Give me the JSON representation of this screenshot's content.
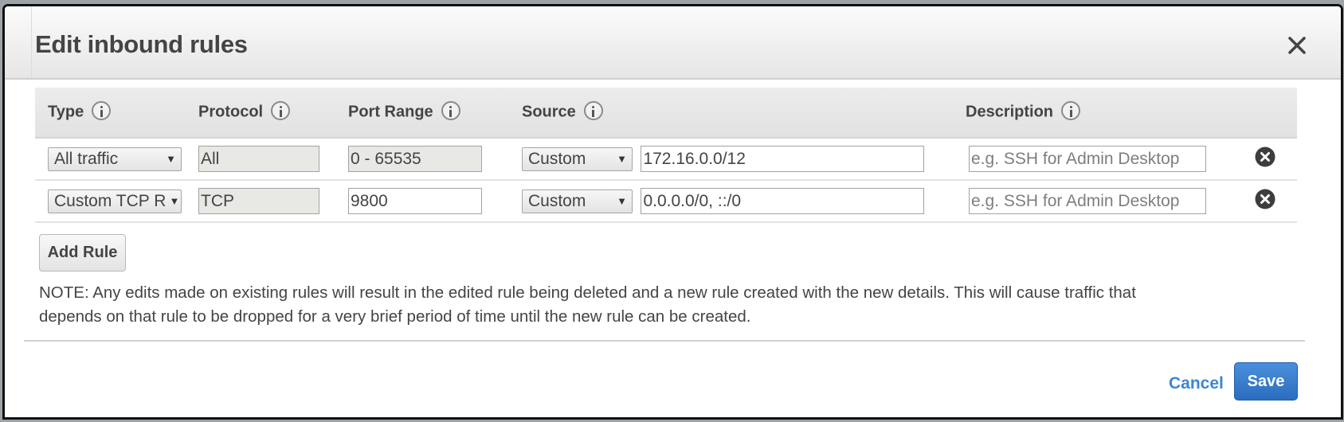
{
  "dialog": {
    "title": "Edit inbound rules",
    "close_icon": "close-icon"
  },
  "table": {
    "headers": [
      {
        "label": "Type",
        "icon": "info-icon"
      },
      {
        "label": "Protocol",
        "icon": "info-icon"
      },
      {
        "label": "Port Range",
        "icon": "info-icon"
      },
      {
        "label": "Source",
        "icon": "info-icon"
      },
      {
        "label": "Description",
        "icon": "info-icon"
      }
    ],
    "rows": [
      {
        "type": "All traffic",
        "protocol": "All",
        "port_range": "0 - 65535",
        "port_range_readonly": true,
        "source_type": "Custom",
        "source_value": "172.16.0.0/12",
        "description": "",
        "description_placeholder": "e.g. SSH for Admin Desktop",
        "delete_icon": "remove-circle-icon"
      },
      {
        "type": "Custom TCP R",
        "protocol": "TCP",
        "port_range": "9800",
        "port_range_readonly": false,
        "source_type": "Custom",
        "source_value": "0.0.0.0/0, ::/0",
        "description": "",
        "description_placeholder": "e.g. SSH for Admin Desktop",
        "delete_icon": "remove-circle-icon"
      }
    ]
  },
  "actions": {
    "add_rule_label": "Add Rule",
    "note": "NOTE: Any edits made on existing rules will result in the edited rule being deleted and a new rule created with the new details. This will cause traffic that depends on that rule to be dropped for a very brief period of time until the new rule can be created.",
    "cancel_label": "Cancel",
    "save_label": "Save"
  },
  "colors": {
    "primary": "#2b6dbf",
    "link": "#3b87d4",
    "text": "#444444"
  }
}
